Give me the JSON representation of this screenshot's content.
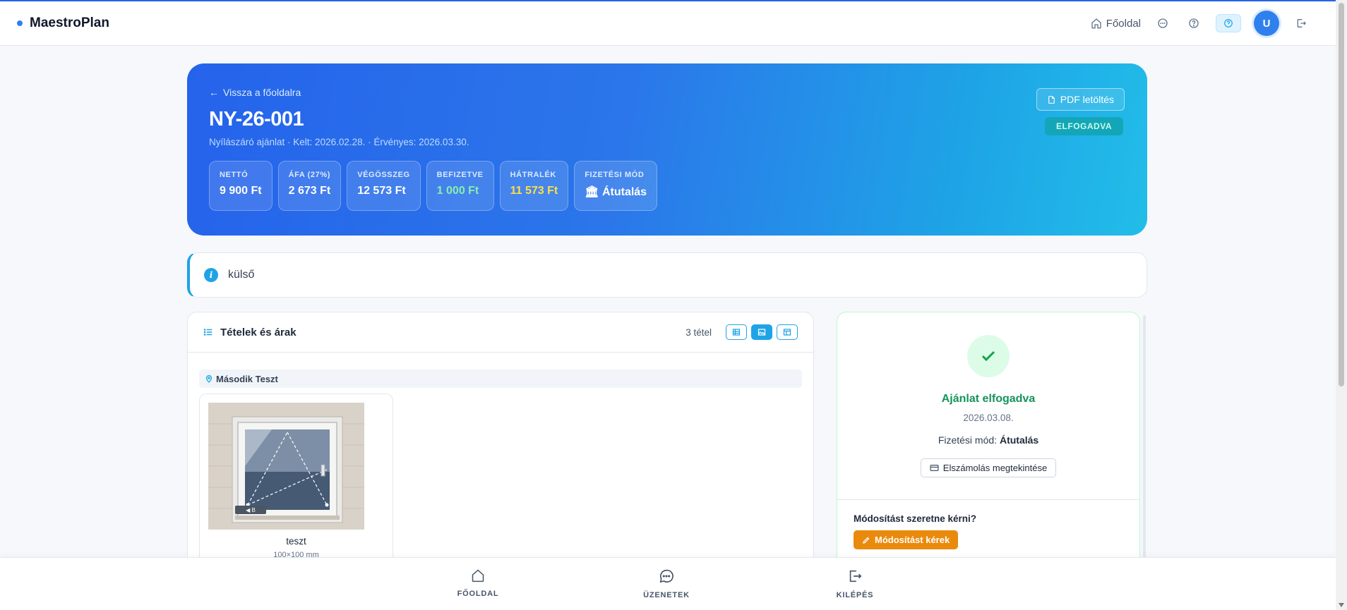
{
  "app": {
    "brand": "MaestroPlan"
  },
  "topbar": {
    "home_label": "Főoldal",
    "avatar_initial": "U"
  },
  "hero": {
    "back_label": "Vissza a főoldalra",
    "title": "NY-26-001",
    "subtitle": "Nyílászáró ajánlat · Kelt: 2026.02.28. · Érvényes: 2026.03.30.",
    "pdf_label": "PDF letöltés",
    "status": "ELFOGADVA",
    "stats": [
      {
        "label": "NETTÓ",
        "value": "9 900 Ft",
        "color": "#ffffff"
      },
      {
        "label": "ÁFA (27%)",
        "value": "2 673 Ft",
        "color": "#ffffff"
      },
      {
        "label": "VÉGÖSSZEG",
        "value": "12 573 Ft",
        "color": "#ffffff"
      },
      {
        "label": "BEFIZETVE",
        "value": "1 000 Ft",
        "color": "#86efac"
      },
      {
        "label": "HÁTRALÉK",
        "value": "11 573 Ft",
        "color": "#fde047"
      },
      {
        "label": "FIZETÉSI MÓD",
        "value": "Átutalás",
        "color": "#ffffff"
      }
    ]
  },
  "notice": {
    "text": "külső"
  },
  "items": {
    "title": "Tételek és árak",
    "count": "3 tétel",
    "location": "Második Teszt",
    "product": {
      "name": "teszt",
      "size": "100×100 mm",
      "tag": "◀ B"
    }
  },
  "acceptance": {
    "title": "Ajánlat elfogadva",
    "date": "2026.03.08.",
    "payment_label": "Fizetési mód:",
    "payment_value": "Átutalás",
    "settle_label": "Elszámolás megtekintése",
    "mod_question": "Módosítást szeretne kérni?",
    "mod_button": "Módosítást kérek"
  },
  "bottom_nav": {
    "home": "FŐOLDAL",
    "messages": "ÜZENETEK",
    "logout": "KILÉPÉS"
  }
}
